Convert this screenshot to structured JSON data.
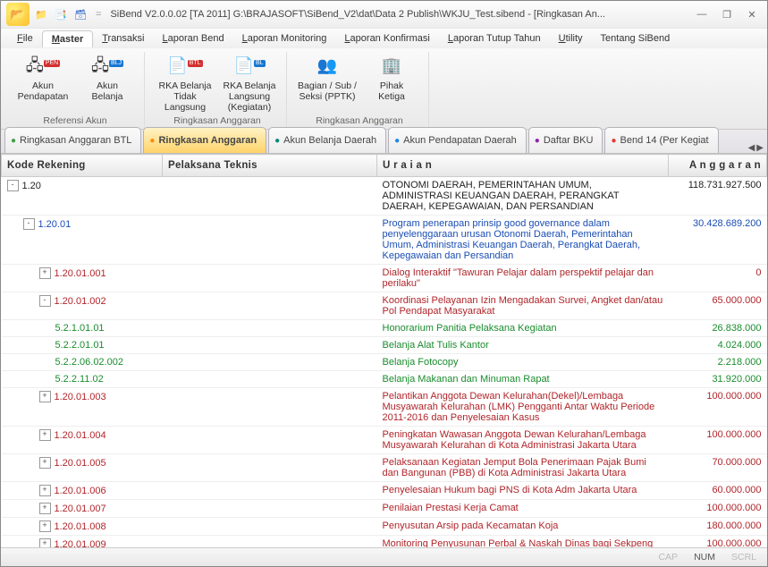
{
  "titlebar": {
    "text": "SiBend V2.0.0.02 [TA 2011] G:\\BRAJASOFT\\SiBend_V2\\dat\\Data 2 Publish\\WKJU_Test.sibend - [Ringkasan An..."
  },
  "window_controls": {
    "min": "—",
    "restore": "❐",
    "close": "✕"
  },
  "menus": [
    {
      "label": "File",
      "u": "F"
    },
    {
      "label": "Master",
      "u": "M",
      "active": true
    },
    {
      "label": "Transaksi",
      "u": "T"
    },
    {
      "label": "Laporan Bend",
      "u": "L"
    },
    {
      "label": "Laporan Monitoring",
      "u": "L"
    },
    {
      "label": "Laporan Konfirmasi",
      "u": "L"
    },
    {
      "label": "Laporan Tutup Tahun",
      "u": "L"
    },
    {
      "label": "Utility",
      "u": "U"
    },
    {
      "label": "Tentang SiBend",
      "u": ""
    }
  ],
  "ribbon": {
    "groups": [
      {
        "label": "Referensi Akun",
        "items": [
          {
            "icon": "org",
            "badge": "PEN",
            "line1": "Akun",
            "line2": "Pendapatan"
          },
          {
            "icon": "org",
            "badge": "BLJ",
            "line1": "Akun",
            "line2": "Belanja"
          }
        ]
      },
      {
        "label": "Ringkasan Anggaran",
        "items": [
          {
            "icon": "doc",
            "badge": "BTL",
            "line1": "RKA Belanja",
            "line2": "Tidak Langsung"
          },
          {
            "icon": "doc",
            "badge": "BL",
            "line1": "RKA Belanja",
            "line2": "Langsung (Kegiatan)"
          }
        ]
      },
      {
        "label": "Ringkasan Anggaran",
        "items": [
          {
            "icon": "people",
            "line1": "Bagian / Sub /",
            "line2": "Seksi (PPTK)"
          },
          {
            "icon": "building",
            "line1": "Pihak",
            "line2": "Ketiga"
          }
        ]
      }
    ]
  },
  "tabs": [
    {
      "label": "Ringkasan Anggaran BTL",
      "color": "d-green"
    },
    {
      "label": "Ringkasan Anggaran",
      "color": "d-orange",
      "active": true
    },
    {
      "label": "Akun Belanja Daerah",
      "color": "d-teal"
    },
    {
      "label": "Akun Pendapatan Daerah",
      "color": "d-blue"
    },
    {
      "label": "Daftar BKU",
      "color": "d-purple"
    },
    {
      "label": "Bend 14 (Per Kegiat",
      "color": "d-red"
    }
  ],
  "columns": {
    "c1": "Kode Rekening",
    "c2": "Pelaksana Teknis",
    "c3": "U r a i a n",
    "c4": "A n g g a r a n"
  },
  "rows": [
    {
      "style": "black",
      "indent": 0,
      "exp": "-",
      "code": "1.20",
      "uraian": "OTONOMI DAERAH, PEMERINTAHAN UMUM, ADMINISTRASI KEUANGAN DAERAH, PERANGKAT DAERAH, KEPEGAWAIAN, DAN PERSANDIAN",
      "anggaran": "118.731.927.500"
    },
    {
      "style": "blue",
      "indent": 1,
      "exp": "-",
      "code": "1.20.01",
      "uraian": "Program penerapan prinsip good governance dalam penyelenggaraan urusan Otonomi Daerah, Pemerintahan Umum, Administrasi Keuangan Daerah, Perangkat Daerah, Kepegawaian dan Persandian",
      "anggaran": "30.428.689.200"
    },
    {
      "style": "red",
      "indent": 2,
      "exp": "+",
      "code": "1.20.01.001",
      "uraian": "Dialog Interaktif \"Tawuran Pelajar dalam perspektif pelajar dan perilaku\"",
      "anggaran": "0"
    },
    {
      "style": "red",
      "indent": 2,
      "exp": "-",
      "code": "1.20.01.002",
      "uraian": "Koordinasi Pelayanan Izin Mengadakan Survei, Angket dan/atau Pol Pendapat Masyarakat",
      "anggaran": "65.000.000"
    },
    {
      "style": "green",
      "indent": 3,
      "code": "5.2.1.01.01",
      "uraian": "Honorarium Panitia Pelaksana Kegiatan",
      "anggaran": "26.838.000"
    },
    {
      "style": "green",
      "indent": 3,
      "code": "5.2.2.01.01",
      "uraian": "Belanja Alat Tulis Kantor",
      "anggaran": "4.024.000"
    },
    {
      "style": "green",
      "indent": 3,
      "code": "5.2.2.06.02.002",
      "uraian": "Belanja Fotocopy",
      "anggaran": "2.218.000"
    },
    {
      "style": "green",
      "indent": 3,
      "code": "5.2.2.11.02",
      "uraian": "Belanja Makanan dan Minuman Rapat",
      "anggaran": "31.920.000"
    },
    {
      "style": "red",
      "indent": 2,
      "exp": "+",
      "code": "1.20.01.003",
      "uraian": "Pelantikan Anggota Dewan Kelurahan(Dekel)/Lembaga Musyawarah Kelurahan (LMK) Pengganti Antar Waktu Periode 2011-2016 dan Penyelesaian Kasus",
      "anggaran": "100.000.000"
    },
    {
      "style": "red",
      "indent": 2,
      "exp": "+",
      "code": "1.20.01.004",
      "uraian": "Peningkatan Wawasan Anggota Dewan Kelurahan/Lembaga Musyawarah Kelurahan di Kota Administrasi Jakarta Utara",
      "anggaran": "100.000.000"
    },
    {
      "style": "red",
      "indent": 2,
      "exp": "+",
      "code": "1.20.01.005",
      "uraian": "Pelaksanaan Kegiatan Jemput Bola Penerimaan Pajak Bumi dan Bangunan (PBB) di Kota Administrasi Jakarta Utara",
      "anggaran": "70.000.000"
    },
    {
      "style": "red",
      "indent": 2,
      "exp": "+",
      "code": "1.20.01.006",
      "uraian": "Penyelesaian Hukum bagi PNS di Kota Adm Jakarta Utara",
      "anggaran": "60.000.000"
    },
    {
      "style": "red",
      "indent": 2,
      "exp": "+",
      "code": "1.20.01.007",
      "uraian": "Penilaian Prestasi Kerja Camat",
      "anggaran": "100.000.000"
    },
    {
      "style": "red",
      "indent": 2,
      "exp": "+",
      "code": "1.20.01.008",
      "uraian": "Penyusutan Arsip pada Kecamatan Koja",
      "anggaran": "180.000.000"
    },
    {
      "style": "red",
      "indent": 2,
      "exp": "+",
      "code": "1.20.01.009",
      "uraian": "Monitoring Penyusunan Perbal & Naskah Dinas bagi Sekpeng",
      "anggaran": "100.000.000"
    }
  ],
  "status": {
    "cap": "CAP",
    "num": "NUM",
    "scrl": "SCRL"
  }
}
